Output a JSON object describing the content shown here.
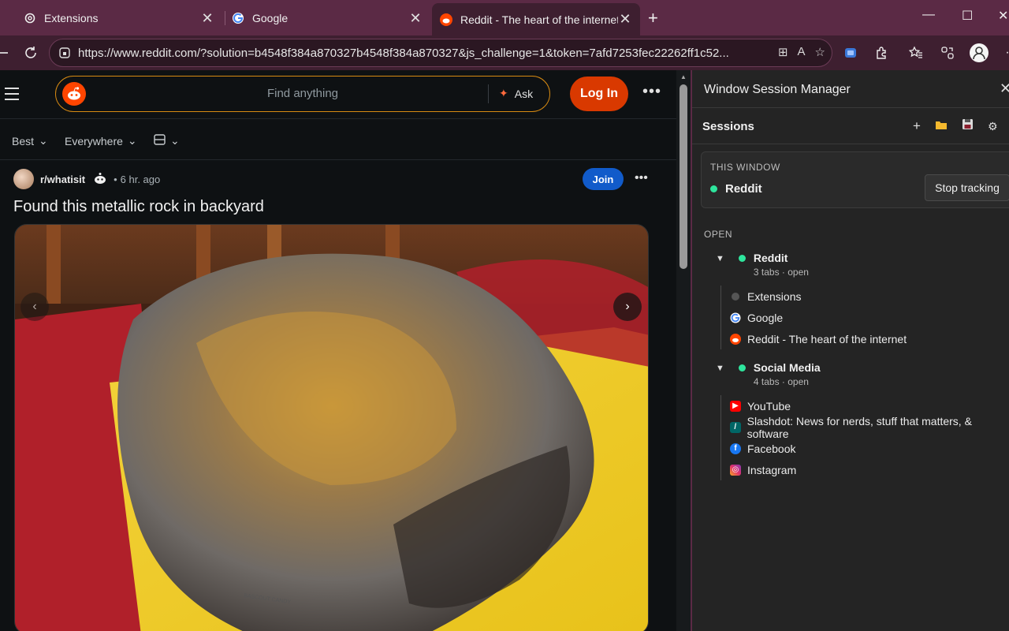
{
  "browser": {
    "tabs": [
      {
        "title": "Extensions",
        "icon": "puzzle-gear-icon",
        "active": false
      },
      {
        "title": "Google",
        "icon": "google-icon",
        "active": false
      },
      {
        "title": "Reddit - The heart of the internet",
        "icon": "reddit-icon",
        "active": true
      }
    ],
    "close_glyph": "✕",
    "new_tab_glyph": "+",
    "window_controls": {
      "minimize": "—",
      "maximize": "☐",
      "close": "✕"
    },
    "url": "https://www.reddit.com/?solution=b4548f384a870327b4548f384a870327&js_challenge=1&token=7afd7253fec22262ff1c52..."
  },
  "reddit": {
    "search_placeholder": "Find anything",
    "ask_label": "Ask",
    "login_label": "Log In",
    "more_glyph": "•••",
    "sort": {
      "best": "Best",
      "scope": "Everywhere"
    },
    "post": {
      "subreddit": "r/whatisit",
      "separator": "•",
      "time": "6 hr. ago",
      "join_label": "Join",
      "title": "Found this metallic rock in backyard"
    },
    "carousel": {
      "prev": "‹",
      "next": "›"
    }
  },
  "panel": {
    "title": "Window Session Manager",
    "close_glyph": "✕",
    "sessions_label": "Sessions",
    "this_window": {
      "label": "THIS WINDOW",
      "name": "Reddit",
      "stop_label": "Stop tracking"
    },
    "open_label": "OPEN",
    "groups": [
      {
        "name": "Reddit",
        "meta": "3 tabs · open",
        "tabs": [
          {
            "title": "Extensions",
            "icon": "gray-dot-icon"
          },
          {
            "title": "Google",
            "icon": "google-icon"
          },
          {
            "title": "Reddit - The heart of the internet",
            "icon": "reddit-icon"
          }
        ]
      },
      {
        "name": "Social Media",
        "meta": "4 tabs · open",
        "tabs": [
          {
            "title": "YouTube",
            "icon": "youtube-icon"
          },
          {
            "title": "Slashdot: News for nerds, stuff that matters, & software",
            "icon": "slashdot-icon"
          },
          {
            "title": "Facebook",
            "icon": "facebook-icon"
          },
          {
            "title": "Instagram",
            "icon": "instagram-icon"
          }
        ]
      }
    ],
    "colors": {
      "active_dot": "#2ee59d",
      "accent": "#5b2a45"
    }
  }
}
